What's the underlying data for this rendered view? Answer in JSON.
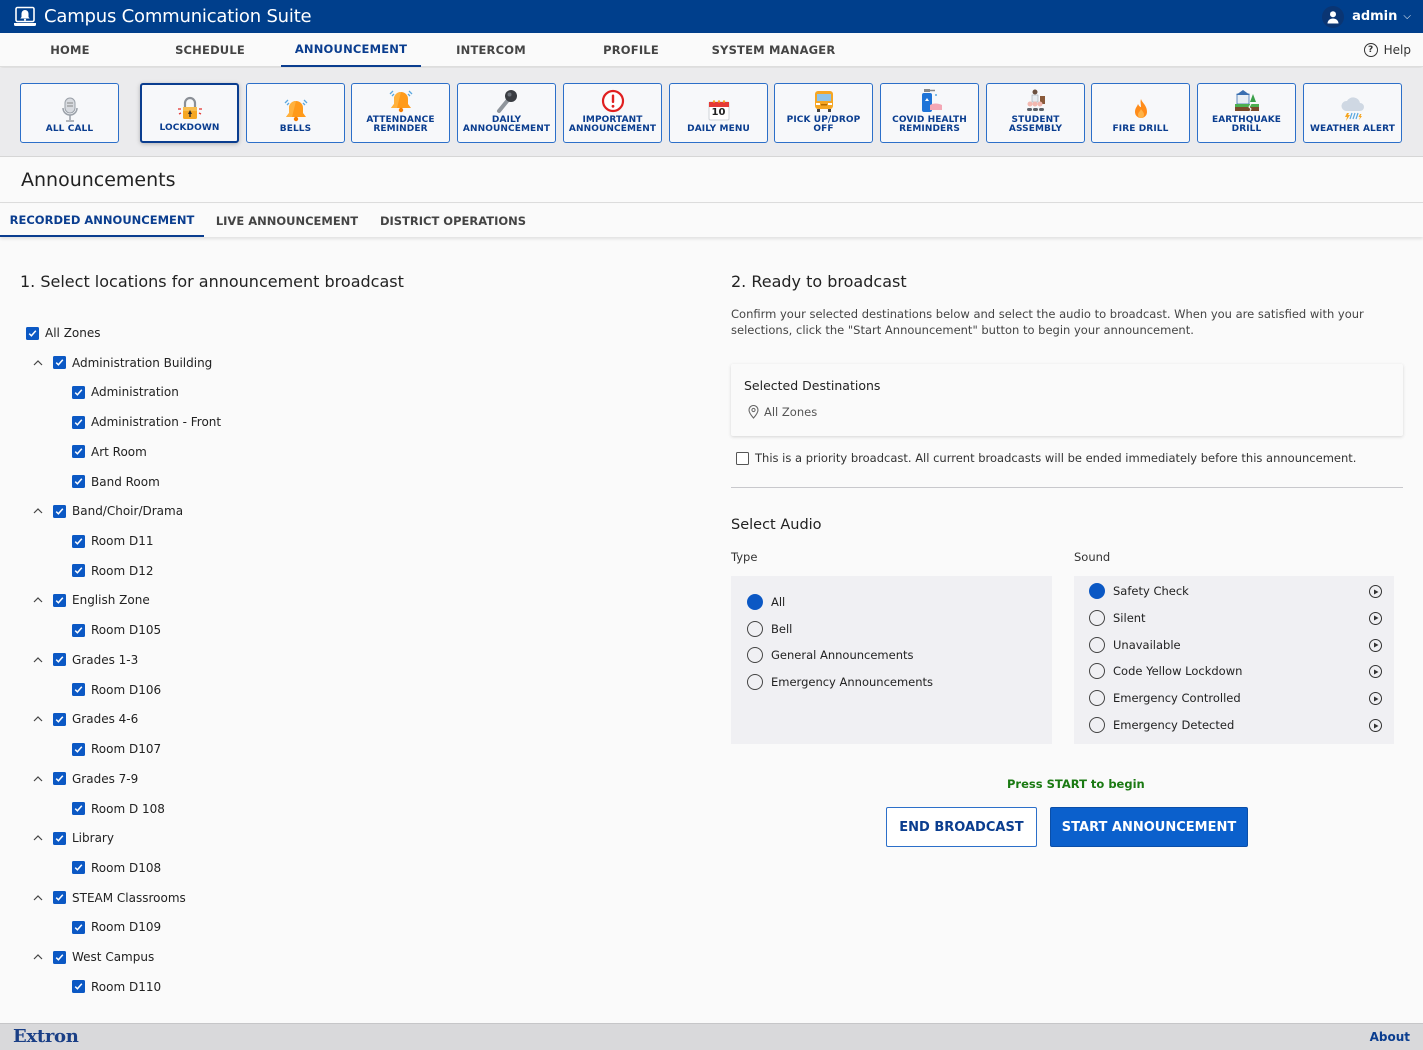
{
  "app": {
    "title": "Campus Communication Suite",
    "user": "admin",
    "help_label": "Help",
    "brand": "Extron",
    "about_label": "About"
  },
  "mainnav": {
    "items": [
      {
        "label": "HOME",
        "active": false
      },
      {
        "label": "SCHEDULE",
        "active": false
      },
      {
        "label": "ANNOUNCEMENT",
        "active": true
      },
      {
        "label": "INTERCOM",
        "active": false
      },
      {
        "label": "PROFILE",
        "active": false
      },
      {
        "label": "SYSTEM MANAGER",
        "active": false
      }
    ]
  },
  "quickbar": {
    "buttons": [
      {
        "line1": "ALL CALL",
        "line2": "",
        "icon": "microphone-icon",
        "active": false
      },
      {
        "line1": "LOCKDOWN",
        "line2": "",
        "icon": "padlock-icon",
        "active": true
      },
      {
        "line1": "BELLS",
        "line2": "",
        "icon": "bell-icon",
        "active": false
      },
      {
        "line1": "ATTENDANCE",
        "line2": "REMINDER",
        "icon": "bell-icon",
        "active": false
      },
      {
        "line1": "DAILY",
        "line2": "ANNOUNCEMENT",
        "icon": "handheld-mic-icon",
        "active": false
      },
      {
        "line1": "IMPORTANT",
        "line2": "ANNOUNCEMENT",
        "icon": "exclamation-icon",
        "active": false
      },
      {
        "line1": "DAILY MENU",
        "line2": "",
        "icon": "calendar-icon",
        "calendar_day": "10",
        "active": false
      },
      {
        "line1": "PICK UP/DROP OFF",
        "line2": "",
        "icon": "school-bus-icon",
        "active": false
      },
      {
        "line1": "COVID HEALTH",
        "line2": "REMINDERS",
        "icon": "hand-sanitizer-icon",
        "active": false
      },
      {
        "line1": "STUDENT",
        "line2": "ASSEMBLY",
        "icon": "assembly-icon",
        "active": false
      },
      {
        "line1": "FIRE DRILL",
        "line2": "",
        "icon": "fire-icon",
        "active": false
      },
      {
        "line1": "EARTHQUAKE",
        "line2": "DRILL",
        "icon": "earthquake-icon",
        "active": false
      },
      {
        "line1": "WEATHER ALERT",
        "line2": "",
        "icon": "storm-cloud-icon",
        "active": false
      }
    ]
  },
  "page": {
    "title": "Announcements",
    "subtabs": [
      {
        "label": "RECORDED ANNOUNCEMENT",
        "active": true
      },
      {
        "label": "LIVE ANNOUNCEMENT",
        "active": false
      },
      {
        "label": "DISTRICT OPERATIONS",
        "active": false
      }
    ]
  },
  "locations": {
    "title": "1. Select locations for announcement broadcast",
    "root": {
      "label": "All Zones",
      "checked": true
    },
    "groups": [
      {
        "label": "Administration Building",
        "checked": true,
        "expanded": true,
        "children": [
          {
            "label": "Administration",
            "checked": true
          },
          {
            "label": "Administration - Front",
            "checked": true
          },
          {
            "label": "Art Room",
            "checked": true
          },
          {
            "label": "Band Room",
            "checked": true
          }
        ]
      },
      {
        "label": "Band/Choir/Drama",
        "checked": true,
        "expanded": true,
        "children": [
          {
            "label": "Room D11",
            "checked": true
          },
          {
            "label": "Room D12",
            "checked": true
          }
        ]
      },
      {
        "label": "English Zone",
        "checked": true,
        "expanded": true,
        "children": [
          {
            "label": "Room D105",
            "checked": true
          }
        ]
      },
      {
        "label": "Grades 1-3",
        "checked": true,
        "expanded": true,
        "children": [
          {
            "label": "Room D106",
            "checked": true
          }
        ]
      },
      {
        "label": "Grades 4-6",
        "checked": true,
        "expanded": true,
        "children": [
          {
            "label": "Room D107",
            "checked": true
          }
        ]
      },
      {
        "label": "Grades 7-9",
        "checked": true,
        "expanded": true,
        "children": [
          {
            "label": "Room D 108",
            "checked": true
          }
        ]
      },
      {
        "label": "Library",
        "checked": true,
        "expanded": true,
        "children": [
          {
            "label": "Room D108",
            "checked": true
          }
        ]
      },
      {
        "label": "STEAM Classrooms",
        "checked": true,
        "expanded": true,
        "children": [
          {
            "label": "Room D109",
            "checked": true
          }
        ]
      },
      {
        "label": "West Campus",
        "checked": true,
        "expanded": true,
        "children": [
          {
            "label": "Room D110",
            "checked": true
          }
        ]
      }
    ]
  },
  "broadcast": {
    "title": "2. Ready to broadcast",
    "description": "Confirm your selected destinations below and select the audio to broadcast. When you are satisfied with your selections, click the \"Start Announcement\" button to begin your announcement.",
    "destinations_title": "Selected Destinations",
    "destinations": [
      "All Zones"
    ],
    "priority_label": "This is a priority broadcast. All current broadcasts will be ended immediately before this announcement.",
    "priority_checked": false,
    "select_audio_title": "Select Audio",
    "type_label": "Type",
    "sound_label": "Sound",
    "types": [
      {
        "label": "All",
        "selected": true
      },
      {
        "label": "Bell",
        "selected": false
      },
      {
        "label": "General Announcements",
        "selected": false
      },
      {
        "label": "Emergency Announcements",
        "selected": false
      }
    ],
    "sounds": [
      {
        "label": "Safety Check",
        "selected": true
      },
      {
        "label": "Silent",
        "selected": false
      },
      {
        "label": "Unavailable",
        "selected": false
      },
      {
        "label": "Code Yellow Lockdown",
        "selected": false
      },
      {
        "label": "Emergency Controlled",
        "selected": false
      },
      {
        "label": "Emergency Detected",
        "selected": false
      }
    ],
    "status_text": "Press START to begin",
    "end_label": "END BROADCAST",
    "start_label": "START ANNOUNCEMENT"
  },
  "colors": {
    "brand_blue": "#003f8c",
    "accent_blue": "#0b58c4",
    "status_green": "#1a7a12"
  }
}
